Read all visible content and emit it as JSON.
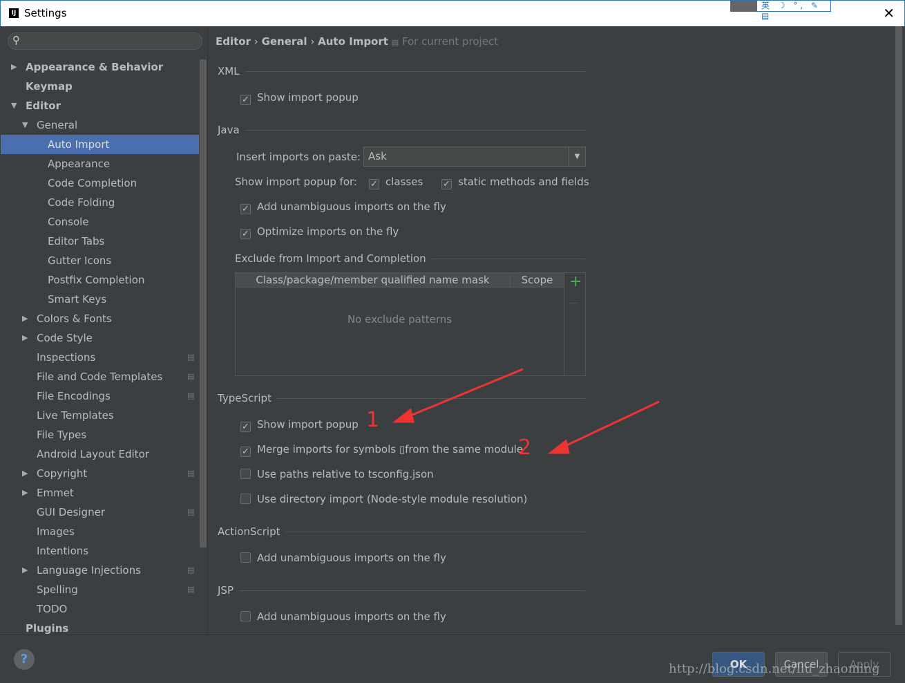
{
  "window": {
    "title": "Settings",
    "close": "✕",
    "ime": "英 ☽ °, ✎ ▤"
  },
  "sidebar": {
    "items": [
      {
        "label": "Appearance & Behavior",
        "level": 0,
        "arrow": "▶",
        "bold": true
      },
      {
        "label": "Keymap",
        "level": 0,
        "bold": true
      },
      {
        "label": "Editor",
        "level": 0,
        "arrow": "▼",
        "bold": true
      },
      {
        "label": "General",
        "level": 1,
        "arrow": "▼"
      },
      {
        "label": "Auto Import",
        "level": 2,
        "selected": true
      },
      {
        "label": "Appearance",
        "level": 2
      },
      {
        "label": "Code Completion",
        "level": 2
      },
      {
        "label": "Code Folding",
        "level": 2
      },
      {
        "label": "Console",
        "level": 2
      },
      {
        "label": "Editor Tabs",
        "level": 2
      },
      {
        "label": "Gutter Icons",
        "level": 2
      },
      {
        "label": "Postfix Completion",
        "level": 2
      },
      {
        "label": "Smart Keys",
        "level": 2
      },
      {
        "label": "Colors & Fonts",
        "level": 1,
        "arrow": "▶"
      },
      {
        "label": "Code Style",
        "level": 1,
        "arrow": "▶"
      },
      {
        "label": "Inspections",
        "level": 1,
        "proj": true
      },
      {
        "label": "File and Code Templates",
        "level": 1,
        "proj": true
      },
      {
        "label": "File Encodings",
        "level": 1,
        "proj": true
      },
      {
        "label": "Live Templates",
        "level": 1
      },
      {
        "label": "File Types",
        "level": 1
      },
      {
        "label": "Android Layout Editor",
        "level": 1
      },
      {
        "label": "Copyright",
        "level": 1,
        "arrow": "▶",
        "proj": true
      },
      {
        "label": "Emmet",
        "level": 1,
        "arrow": "▶"
      },
      {
        "label": "GUI Designer",
        "level": 1,
        "proj": true
      },
      {
        "label": "Images",
        "level": 1
      },
      {
        "label": "Intentions",
        "level": 1
      },
      {
        "label": "Language Injections",
        "level": 1,
        "arrow": "▶",
        "proj": true
      },
      {
        "label": "Spelling",
        "level": 1,
        "proj": true
      },
      {
        "label": "TODO",
        "level": 1
      },
      {
        "label": "Plugins",
        "level": 0,
        "bold": true
      }
    ]
  },
  "breadcrumb": {
    "editor": "Editor",
    "general": "General",
    "auto_import": "Auto Import",
    "sep": "›",
    "scope": "For current project"
  },
  "xml": {
    "title": "XML",
    "show_popup": "Show import popup"
  },
  "java": {
    "title": "Java",
    "insert_label": "Insert imports on paste:",
    "insert_value": "Ask",
    "show_for": "Show import popup for:",
    "classes": "classes",
    "static": "static methods and fields",
    "unambiguous": "Add unambiguous imports on the fly",
    "optimize": "Optimize imports on the fly",
    "exclude_title": "Exclude from Import and Completion",
    "col_mask": "Class/package/member qualified name mask",
    "col_scope": "Scope",
    "empty": "No exclude patterns",
    "add": "+",
    "remove": "—"
  },
  "typescript": {
    "title": "TypeScript",
    "show_popup": "Show import popup",
    "merge": "Merge imports for symbols ▯from the same module",
    "paths": "Use paths relative to tsconfig.json",
    "directory": "Use directory import (Node-style module resolution)"
  },
  "actionscript": {
    "title": "ActionScript",
    "unambiguous": "Add unambiguous imports on the fly"
  },
  "jsp": {
    "title": "JSP",
    "unambiguous": "Add unambiguous imports on the fly"
  },
  "annotations": {
    "one": "1",
    "two": "2"
  },
  "footer": {
    "help": "?",
    "ok": "OK",
    "cancel": "Cancel",
    "apply": "Apply",
    "watermark": "http://blog.csdn.net/liu_zhaoming"
  }
}
